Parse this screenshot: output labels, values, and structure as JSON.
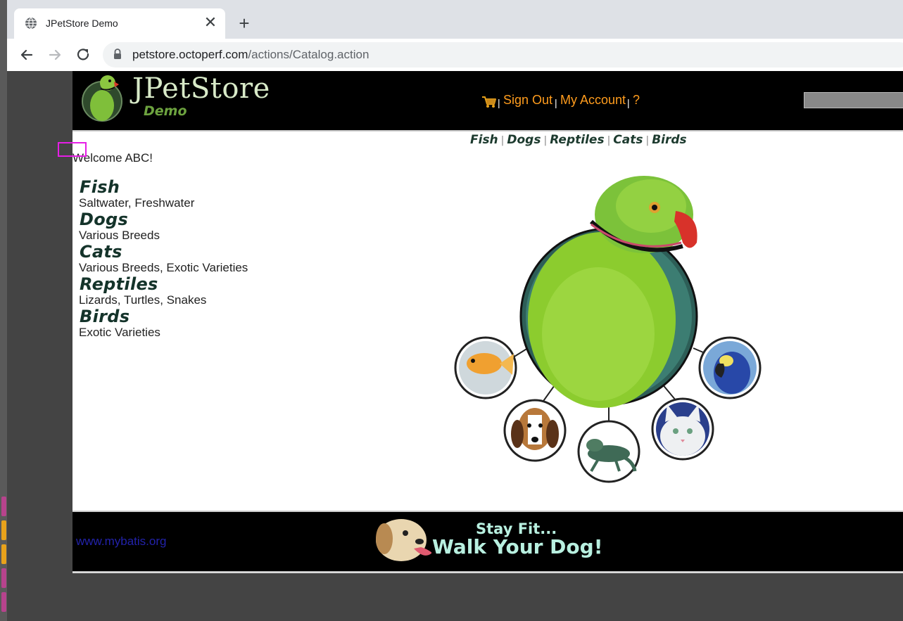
{
  "browser": {
    "tab_title": "JPetStore Demo",
    "tab_close": "✕",
    "new_tab": "+",
    "url_host": "petstore.octoperf.com",
    "url_path": "/actions/Catalog.action"
  },
  "header": {
    "logo_title": "JPetStore",
    "logo_subtitle": "Demo",
    "sign_out": "Sign Out",
    "my_account": "My Account",
    "help": "?",
    "separator": "|",
    "search_placeholder": ""
  },
  "quick_links": [
    "Fish",
    "Dogs",
    "Reptiles",
    "Cats",
    "Birds"
  ],
  "welcome": "Welcome ABC!",
  "categories": [
    {
      "name": "Fish",
      "desc": "Saltwater, Freshwater"
    },
    {
      "name": "Dogs",
      "desc": "Various Breeds"
    },
    {
      "name": "Cats",
      "desc": "Various Breeds, Exotic Varieties"
    },
    {
      "name": "Reptiles",
      "desc": "Lizards, Turtles, Snakes"
    },
    {
      "name": "Birds",
      "desc": "Exotic Varieties"
    }
  ],
  "footer": {
    "link": "www.mybatis.org",
    "banner_line1": "Stay Fit...",
    "banner_line2": "Walk Your Dog!"
  },
  "colors": {
    "menu_link": "#ff9c1d",
    "category_title": "#14332a",
    "focus_outline": "#e61ee6",
    "footer_link": "#2222aa"
  }
}
